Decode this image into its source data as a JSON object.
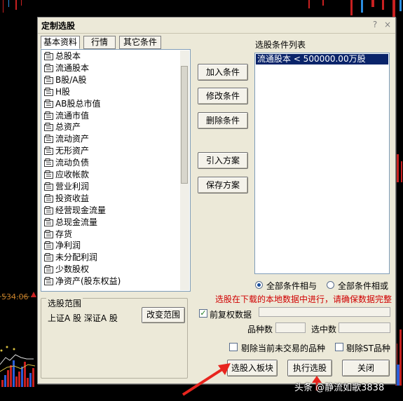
{
  "window": {
    "title": "定制选股",
    "help": "?",
    "close": "×"
  },
  "tabs": [
    "基本资料",
    "行情",
    "其它条件"
  ],
  "fields": [
    "总股本",
    "流通股本",
    "B股/A股",
    "H股",
    "AB股总市值",
    "流通市值",
    "总资产",
    "流动资产",
    "无形资产",
    "流动负债",
    "应收帐款",
    "营业利润",
    "投资收益",
    "经营现金流量",
    "总现金流量",
    "存货",
    "净利润",
    "未分配利润",
    "少数股权",
    "净资产(股东权益)"
  ],
  "buttons": {
    "add": "加入条件",
    "modify": "修改条件",
    "delete": "删除条件",
    "import": "引入方案",
    "save": "保存方案",
    "change_range": "改变范围",
    "to_block": "选股入板块",
    "execute": "执行选股",
    "close": "关闭"
  },
  "conditions": {
    "header": "选股条件列表",
    "items": [
      "流通股本 < 500000.00万股"
    ]
  },
  "logic": {
    "and_label": "全部条件相与",
    "or_label": "全部条件相或",
    "selected": "and"
  },
  "warning": "选股在下载的本地数据中进行，请确保数据完整",
  "range": {
    "title": "选股范围",
    "value": "上证A 股  深证A 股"
  },
  "options": {
    "reinstate": "前复权数据",
    "reinstate_checked": true,
    "exclude_untraded": "剔除当前未交易的品种",
    "exclude_st": "剔除ST品种"
  },
  "stats": {
    "count_label": "品种数",
    "selected_label": "选中数"
  },
  "chart": {
    "price_label": "534.06"
  },
  "watermark": "头条 @静流如歌3838",
  "colors": {
    "selection": "#0a246a",
    "warning": "#d00000",
    "arrow": "#e8251e"
  }
}
